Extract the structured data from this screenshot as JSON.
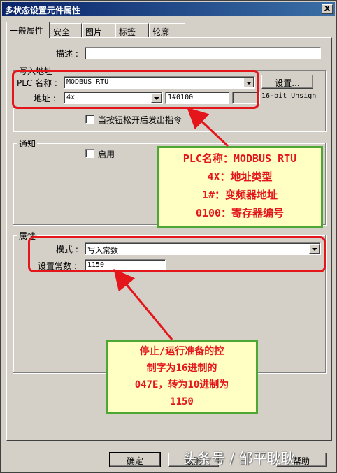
{
  "window": {
    "title": "多状态设置元件属性",
    "close_label": "X"
  },
  "tabs": [
    "一般属性",
    "安全",
    "图片",
    "标签",
    "轮廓"
  ],
  "general": {
    "description_label": "描述 :",
    "description_value": "",
    "write_address": {
      "title": "写入地址",
      "plc_name_label": "PLC 名称 :",
      "plc_name_value": "MODBUS RTU",
      "settings_button": "设置...",
      "address_label": "地址 :",
      "address_type": "4x",
      "address_value": "1#0100",
      "data_format": "16-bit Unsign",
      "release_checkbox_label": "当按钮松开后发出指令",
      "release_checked": false
    },
    "notify": {
      "title": "通知",
      "enable_label": "启用",
      "enable_checked": false
    },
    "attributes": {
      "title": "属性",
      "mode_label": "模式 :",
      "mode_value": "写入常数",
      "constant_label": "设置常数 :",
      "constant_value": "1150"
    }
  },
  "buttons": {
    "ok": "确定",
    "cancel": "取消",
    "help": "帮助"
  },
  "annotations": {
    "callout1": [
      "PLC名称：MODBUS RTU",
      "4X：地址类型",
      "1#：变频器地址",
      "0100：寄存器编号"
    ],
    "callout2": [
      "停止/运行准备的控",
      "制字为16进制的",
      "047E，转为10进制为",
      "1150"
    ]
  },
  "watermark": "头条号 / 邹平耿耿",
  "colors": {
    "annotation_red": "#e4161b",
    "callout_border": "#4ca832",
    "callout_fill": "#ffffc4",
    "title_blue": "#0a246a"
  }
}
